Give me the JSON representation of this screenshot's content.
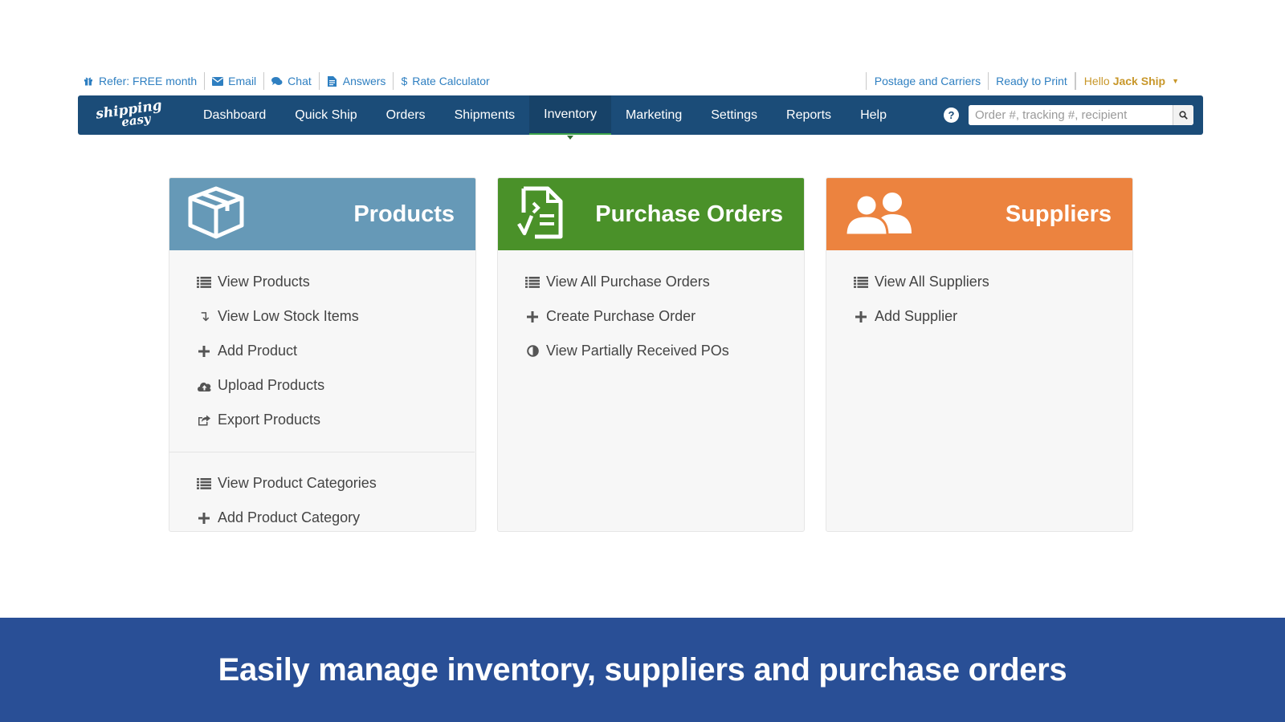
{
  "utility": {
    "left_links": [
      {
        "label": "Refer: FREE month",
        "icon": "gift-icon"
      },
      {
        "label": "Email",
        "icon": "envelope-icon"
      },
      {
        "label": "Chat",
        "icon": "chat-bubbles-icon"
      },
      {
        "label": "Answers",
        "icon": "document-icon"
      },
      {
        "label": "Rate Calculator",
        "icon": "dollar-icon"
      }
    ],
    "right_links": [
      "Postage and Carriers",
      "Ready to Print"
    ],
    "user_greeting": "Hello",
    "user_name": "Jack Ship"
  },
  "nav": {
    "logo_line1": "shipping",
    "logo_line2": "easy",
    "items": [
      "Dashboard",
      "Quick Ship",
      "Orders",
      "Shipments",
      "Inventory",
      "Marketing",
      "Settings",
      "Reports",
      "Help"
    ],
    "active": "Inventory",
    "search_placeholder": "Order #, tracking #, recipient"
  },
  "cards": {
    "products": {
      "title": "Products",
      "color": "#6699b7",
      "items": [
        "View Products",
        "View Low Stock Items",
        "Add Product",
        "Upload Products",
        "Export Products"
      ],
      "items2": [
        "View Product Categories",
        "Add Product Category"
      ]
    },
    "purchase_orders": {
      "title": "Purchase Orders",
      "color": "#4a9129",
      "items": [
        "View All Purchase Orders",
        "Create Purchase Order",
        "View Partially Received POs"
      ]
    },
    "suppliers": {
      "title": "Suppliers",
      "color": "#ec833f",
      "items": [
        "View All Suppliers",
        "Add Supplier"
      ]
    }
  },
  "banner": {
    "text": "Easily manage inventory, suppliers and purchase orders"
  }
}
